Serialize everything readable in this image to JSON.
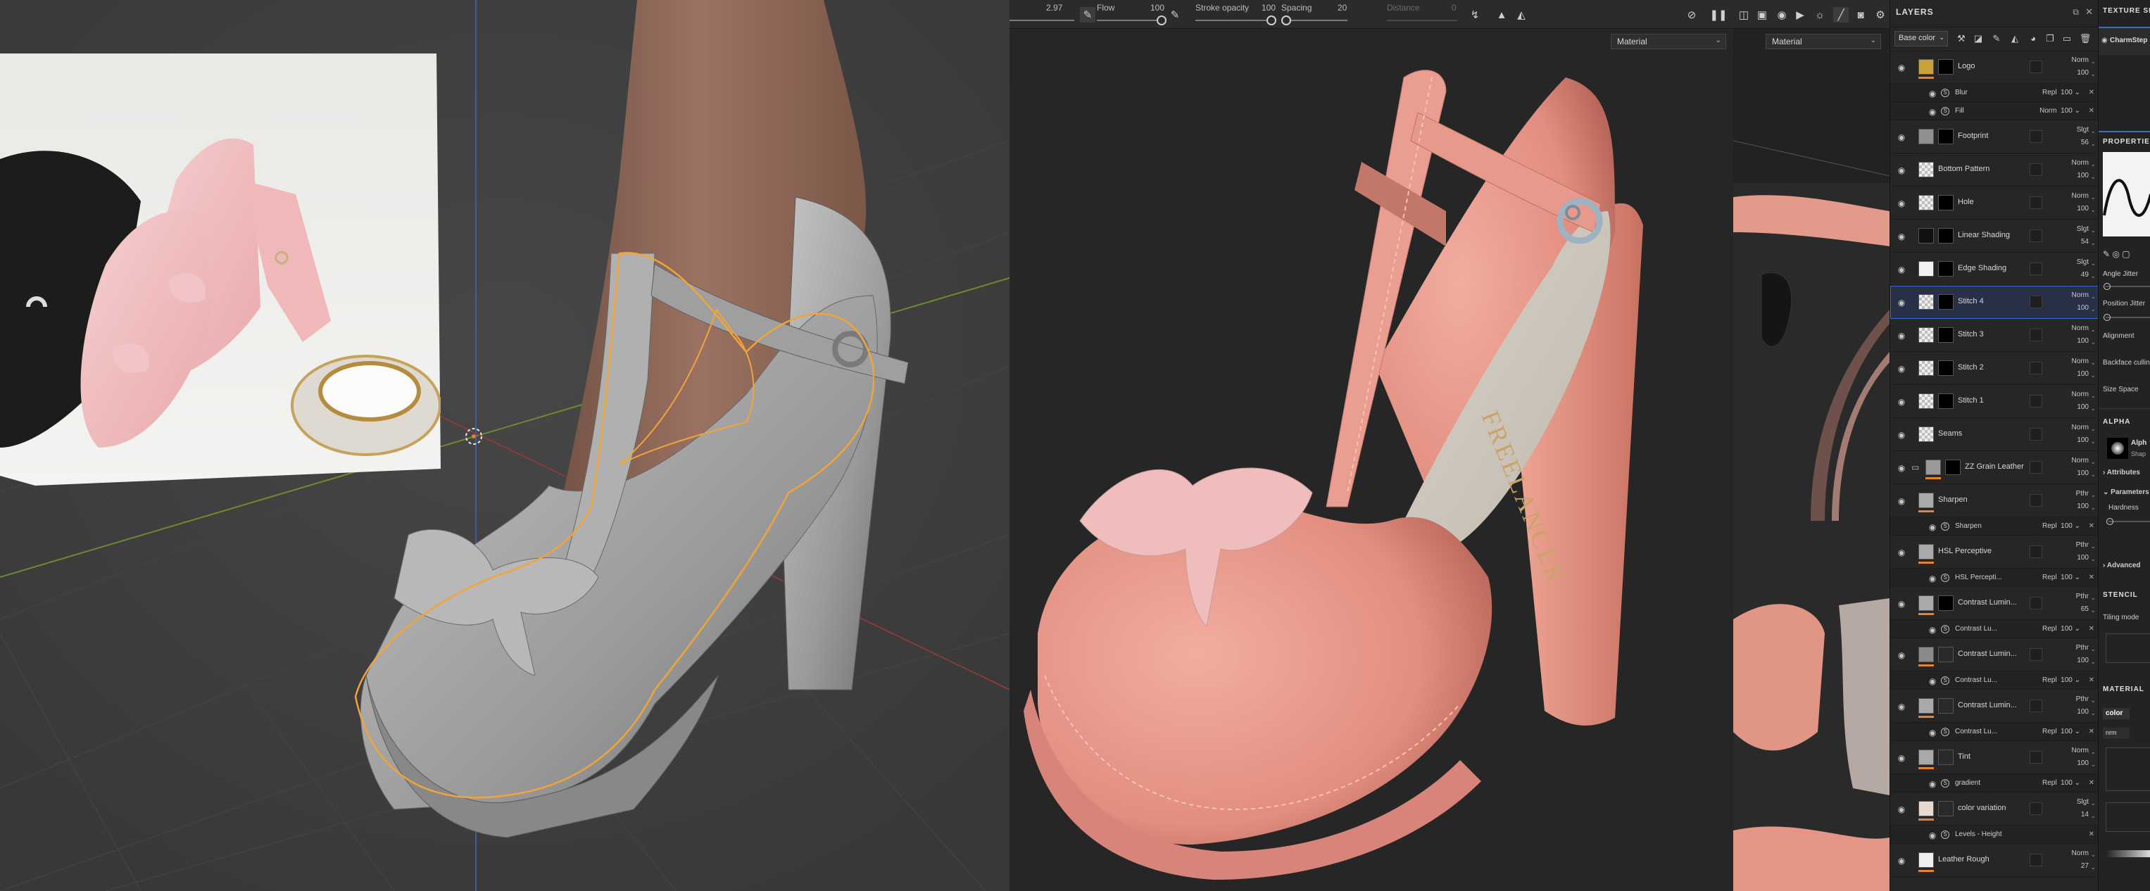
{
  "toolbar": {
    "size_value": "2.97",
    "flow_label": "Flow",
    "flow_value": "100",
    "stroke_opacity_label": "Stroke opacity",
    "stroke_opacity_value": "100",
    "spacing_label": "Spacing",
    "spacing_value": "20",
    "distance_label": "Distance",
    "distance_value": "0",
    "flow_level": 1.0,
    "stroke_opacity_level": 1.0,
    "spacing_level": 0.05
  },
  "viewports": {
    "center_mode": "Material",
    "uv_mode": "Material"
  },
  "shoe_text": "FREELANCER",
  "layers_panel": {
    "title": "LAYERS",
    "channel": "Base color",
    "rows": [
      {
        "kind": "main",
        "name": "Logo",
        "blend": "Norm",
        "value": "100",
        "thumb": "#c9a23b",
        "mask": "black",
        "orange": true
      },
      {
        "kind": "sub",
        "name": "Blur",
        "blend": "Repl",
        "value": "100"
      },
      {
        "kind": "sub",
        "name": "Fill",
        "blend": "Norm",
        "value": "100"
      },
      {
        "kind": "main",
        "name": "Footprint",
        "blend": "Slgt",
        "value": "56",
        "thumb": "#909090",
        "mask": "black",
        "orange": false
      },
      {
        "kind": "main",
        "name": "Bottom Pattern",
        "blend": "Norm",
        "value": "100",
        "thumb": "checker",
        "mask": "",
        "orange": false
      },
      {
        "kind": "main",
        "name": "Hole",
        "blend": "Norm",
        "value": "100",
        "thumb": "checker",
        "mask": "black",
        "orange": false
      },
      {
        "kind": "main",
        "name": "Linear Shading",
        "blend": "Slgt",
        "value": "54",
        "thumb": "#111111",
        "mask": "black",
        "orange": false
      },
      {
        "kind": "main",
        "name": "Edge Shading",
        "blend": "Slgt",
        "value": "49",
        "thumb": "#f2f2f2",
        "mask": "black",
        "orange": false
      },
      {
        "kind": "main",
        "name": "Stitch 4",
        "blend": "Norm",
        "value": "100",
        "thumb": "checker",
        "mask": "black",
        "orange": false,
        "selected": true
      },
      {
        "kind": "main",
        "name": "Stitch 3",
        "blend": "Norm",
        "value": "100",
        "thumb": "checker",
        "mask": "black",
        "orange": false
      },
      {
        "kind": "main",
        "name": "Stitch 2",
        "blend": "Norm",
        "value": "100",
        "thumb": "checker",
        "mask": "black",
        "orange": false
      },
      {
        "kind": "main",
        "name": "Stitch 1",
        "blend": "Norm",
        "value": "100",
        "thumb": "checker",
        "mask": "black",
        "orange": false
      },
      {
        "kind": "main",
        "name": "Seams",
        "blend": "Norm",
        "value": "100",
        "thumb": "checker",
        "mask": "",
        "orange": false
      },
      {
        "kind": "main",
        "name": "ZZ Grain Leather",
        "blend": "Norm",
        "value": "100",
        "thumb": "#9a9a9a",
        "mask": "black",
        "orange": true,
        "folder": true
      },
      {
        "kind": "main",
        "name": "Sharpen",
        "blend": "Pthr",
        "value": "100",
        "thumb": "#a9a9a9",
        "mask": "",
        "orange": true
      },
      {
        "kind": "sub",
        "name": "Sharpen",
        "blend": "Repl",
        "value": "100"
      },
      {
        "kind": "main",
        "name": "HSL Perceptive",
        "blend": "Pthr",
        "value": "100",
        "thumb": "#a9a9a9",
        "mask": "",
        "orange": true
      },
      {
        "kind": "sub",
        "name": "HSL Percepti...",
        "blend": "Repl",
        "value": "100"
      },
      {
        "kind": "main",
        "name": "Contrast Lumin...",
        "blend": "Pthr",
        "value": "65",
        "thumb": "#a9a9a9",
        "mask": "black",
        "orange": true
      },
      {
        "kind": "sub",
        "name": "Contrast Lu...",
        "blend": "Repl",
        "value": "100"
      },
      {
        "kind": "main",
        "name": "Contrast Lumin...",
        "blend": "Pthr",
        "value": "100",
        "thumb": "#8a8a8a",
        "mask": "dark",
        "orange": true
      },
      {
        "kind": "sub",
        "name": "Contrast Lu...",
        "blend": "Repl",
        "value": "100"
      },
      {
        "kind": "main",
        "name": "Contrast Lumin...",
        "blend": "Pthr",
        "value": "100",
        "thumb": "#a9a9a9",
        "mask": "dark",
        "orange": true
      },
      {
        "kind": "sub",
        "name": "Contrast Lu...",
        "blend": "Repl",
        "value": "100"
      },
      {
        "kind": "main",
        "name": "Tint",
        "blend": "Norm",
        "value": "100",
        "thumb": "#a9a9a9",
        "mask": "dark",
        "orange": true
      },
      {
        "kind": "sub",
        "name": "gradient",
        "blend": "Repl",
        "value": "100"
      },
      {
        "kind": "main",
        "name": "color variation",
        "blend": "Slgt",
        "value": "14",
        "thumb": "#e8d9cf",
        "mask": "dark",
        "orange": true
      },
      {
        "kind": "sub",
        "name": "Levels - Height",
        "blend": "",
        "value": ""
      },
      {
        "kind": "main",
        "name": "Leather Rough",
        "blend": "Norm",
        "value": "27",
        "thumb": "#f0f0f0",
        "mask": "",
        "orange": true
      }
    ]
  },
  "texture_set": {
    "title": "TEXTURE SET",
    "set_name": "CharmStep",
    "properties_title": "PROPERTIES",
    "angle_jitter": "Angle Jitter",
    "position_jitter": "Position Jitter",
    "alignment": "Alignment",
    "backface": "Backface culling",
    "size_space": "Size Space",
    "alpha_title": "ALPHA",
    "alpha_name": "Alph",
    "alpha_sub": "Shap",
    "attributes": "Attributes",
    "parameters": "Parameters",
    "hardness": "Hardness",
    "advanced": "Advanced",
    "stencil_title": "STENCIL",
    "tiling_mode": "Tiling mode",
    "material_title": "MATERIAL",
    "mat_color": "color",
    "mat_nrm": "nrm"
  },
  "colors": {
    "accent_orange": "#e8832b",
    "selection_blue": "#3d6dc4",
    "shoe_pink": "#e99c8f",
    "clay_gray": "#a7a7a7"
  }
}
